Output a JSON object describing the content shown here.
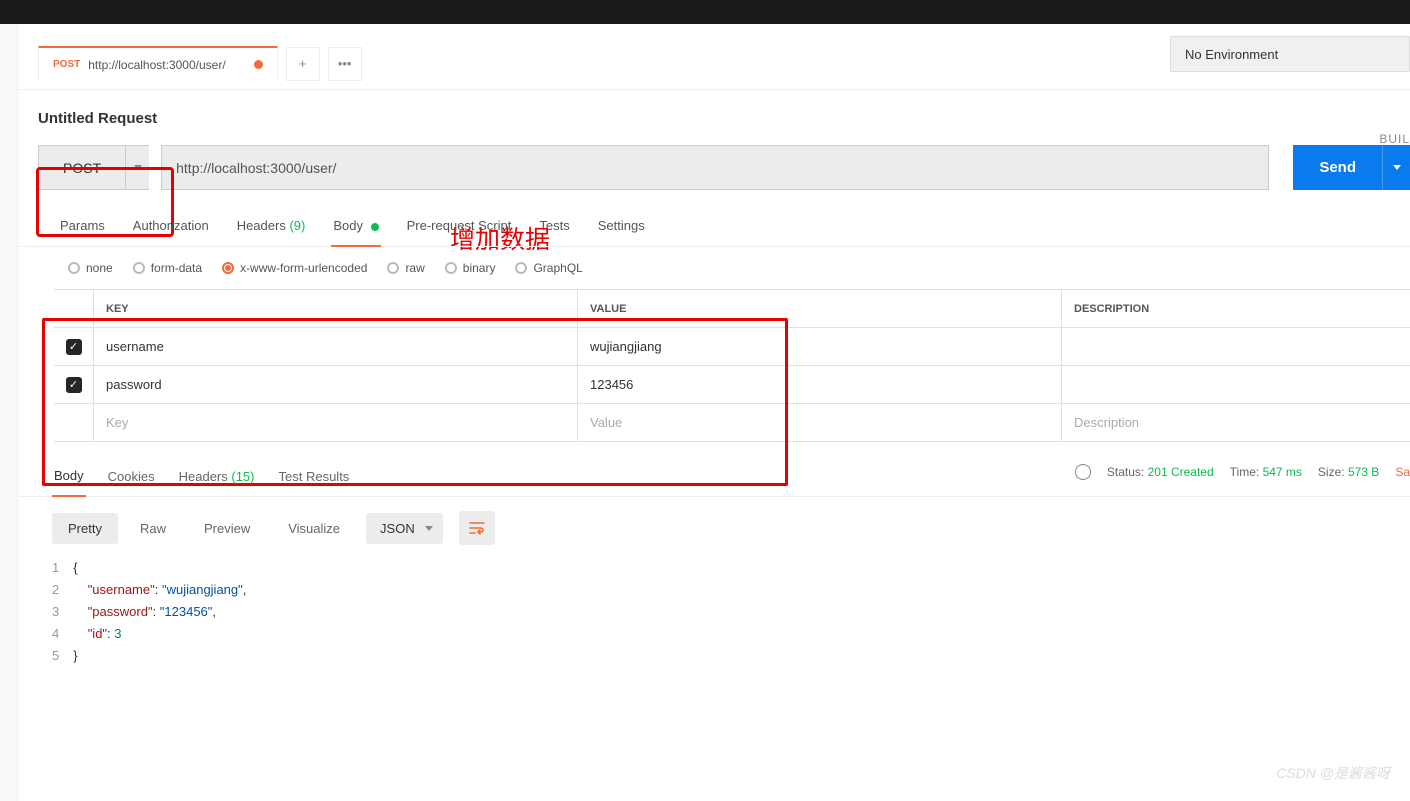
{
  "topTab": {
    "method": "POST",
    "url": "http://localhost:3000/user/"
  },
  "env": {
    "label": "No Environment"
  },
  "request": {
    "title": "Untitled Request",
    "buildLabel": "BUIL"
  },
  "urlBar": {
    "method": "POST",
    "url": "http://localhost:3000/user/",
    "send": "Send"
  },
  "annotation": "增加数据",
  "reqTabs": {
    "params": "Params",
    "auth": "Authorization",
    "headers": "Headers",
    "headersCount": "(9)",
    "body": "Body",
    "prereq": "Pre-request Script",
    "tests": "Tests",
    "settings": "Settings"
  },
  "bodyTypes": {
    "none": "none",
    "formdata": "form-data",
    "urlencoded": "x-www-form-urlencoded",
    "raw": "raw",
    "binary": "binary",
    "graphql": "GraphQL"
  },
  "kv": {
    "headers": {
      "key": "KEY",
      "value": "VALUE",
      "desc": "DESCRIPTION"
    },
    "rows": [
      {
        "key": "username",
        "value": "wujiangjiang"
      },
      {
        "key": "password",
        "value": "123456"
      }
    ],
    "placeholders": {
      "key": "Key",
      "value": "Value",
      "desc": "Description"
    }
  },
  "respTabs": {
    "body": "Body",
    "cookies": "Cookies",
    "headers": "Headers",
    "headersCount": "(15)",
    "tests": "Test Results"
  },
  "respMeta": {
    "statusLabel": "Status:",
    "statusVal": "201 Created",
    "timeLabel": "Time:",
    "timeVal": "547 ms",
    "sizeLabel": "Size:",
    "sizeVal": "573 B",
    "save": "Sa"
  },
  "viewModes": {
    "pretty": "Pretty",
    "raw": "Raw",
    "preview": "Preview",
    "visualize": "Visualize",
    "format": "JSON"
  },
  "responseBody": {
    "l1": "{",
    "l2k": "\"username\"",
    "l2v": "\"wujiangjiang\"",
    "l3k": "\"password\"",
    "l3v": "\"123456\"",
    "l4k": "\"id\"",
    "l4v": "3",
    "l5": "}"
  },
  "watermark": "CSDN @是酱酱呀"
}
